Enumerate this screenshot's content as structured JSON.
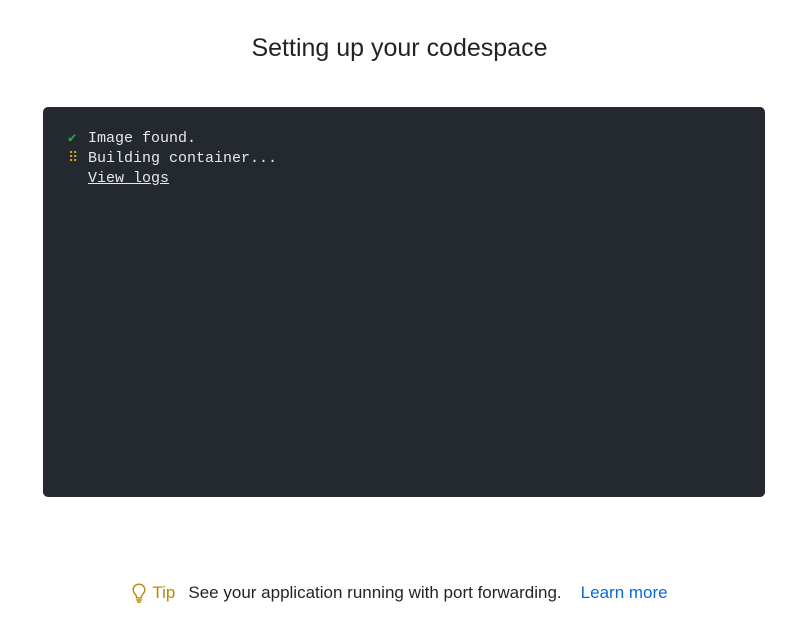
{
  "page": {
    "title": "Setting up your codespace"
  },
  "terminal": {
    "lines": [
      {
        "status": "done",
        "icon": "check-icon",
        "glyph": "✔",
        "text": "Image found."
      },
      {
        "status": "in-progress",
        "icon": "spinner-icon",
        "glyph": "⠿",
        "text": "Building container..."
      }
    ],
    "logs_link": "View logs"
  },
  "tip": {
    "icon": "lightbulb-icon",
    "label": "Tip",
    "text": "See your application running with port forwarding.",
    "link": "Learn more"
  },
  "colors": {
    "terminal_bg": "#24292f",
    "success": "#2da44e",
    "progress": "#d4a72c",
    "tip_label": "#bf8700",
    "link": "#0969da"
  }
}
